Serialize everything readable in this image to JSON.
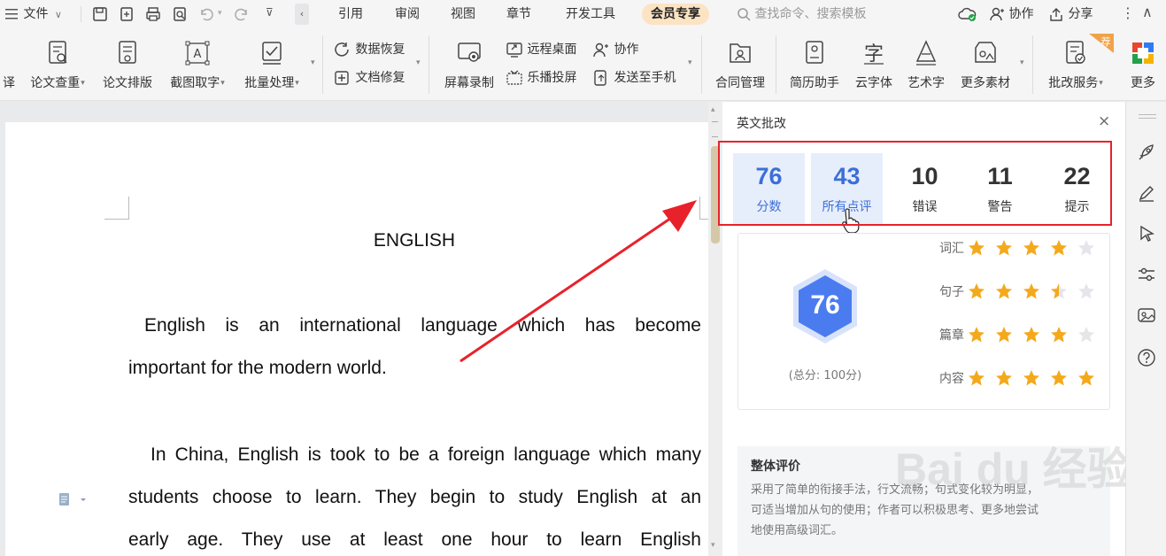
{
  "topbar": {
    "menu_label": "文件",
    "tabs": [
      "引用",
      "审阅",
      "视图",
      "章节",
      "开发工具",
      "会员专享"
    ],
    "active_tab": "会员专享",
    "search_placeholder": "查找命令、搜索模板",
    "collab_label": "协作",
    "share_label": "分享"
  },
  "ribbon": {
    "cut_label": "译",
    "big_buttons": [
      {
        "label": "论文查重",
        "dropdown": true
      },
      {
        "label": "论文排版",
        "dropdown": false
      },
      {
        "label": "截图取字",
        "dropdown": true
      },
      {
        "label": "批量处理",
        "dropdown": true
      }
    ],
    "data_recover": "数据恢复",
    "doc_repair": "文档修复",
    "screen_record": "屏幕录制",
    "remote_desktop": "远程桌面",
    "cooperate": "协作",
    "cast_screen": "乐播投屏",
    "send_phone": "发送至手机",
    "contract": "合同管理",
    "right_buttons": [
      "简历助手",
      "云字体",
      "艺术字",
      "更多素材"
    ],
    "grading_service": "批改服务",
    "grading_badge": "荐",
    "more": "更多"
  },
  "document": {
    "title": "ENGLISH",
    "lines": [
      "English  is  an  international  language  which  has  become",
      "important for the modern world.",
      "In China, English is took to be a foreign language which many",
      "students choose to learn. They begin to study English at an",
      "early  age.  They  use  at  least  one  hour  to  learn  English"
    ]
  },
  "panel": {
    "title": "英文批改",
    "stats": [
      {
        "value": "76",
        "label": "分数"
      },
      {
        "value": "43",
        "label": "所有点评"
      },
      {
        "value": "10",
        "label": "错误"
      },
      {
        "value": "11",
        "label": "警告"
      },
      {
        "value": "22",
        "label": "提示"
      }
    ],
    "score": "76",
    "total_label": "(总分: 100分)",
    "ratings": [
      {
        "label": "词汇",
        "stars": 4
      },
      {
        "label": "句子",
        "stars": 3.5
      },
      {
        "label": "篇章",
        "stars": 4
      },
      {
        "label": "内容",
        "stars": 5
      }
    ],
    "summary_title": "整体评价",
    "summary_text": [
      "采用了简单的衔接手法，行文流畅；句式变化较为明显，",
      "可适当增加从句的使用；作者可以积极思考、更多地尝试",
      "地使用高级词汇。"
    ]
  },
  "watermark": "Bai du 经验",
  "colors": {
    "accent_blue": "#3b6fd8",
    "star": "#f4a91c",
    "highlight_red": "#e8222a",
    "score_hex": "#4a7cf0"
  }
}
